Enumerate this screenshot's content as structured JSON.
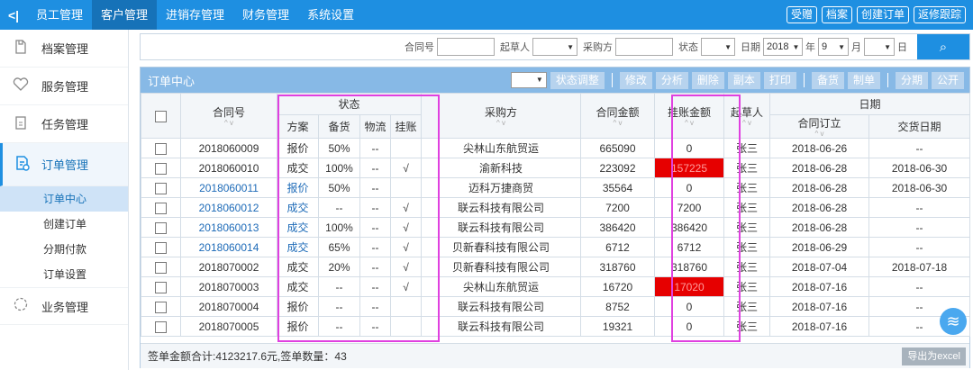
{
  "topnav": {
    "collapse": "<|",
    "items": [
      "员工管理",
      "客户管理",
      "进销存管理",
      "财务管理",
      "系统设置"
    ],
    "right_buttons": [
      "受赠",
      "档案",
      "创建订单",
      "返修跟踪"
    ]
  },
  "sidebar": {
    "items": [
      {
        "label": "档案管理",
        "icon": "file-icon"
      },
      {
        "label": "服务管理",
        "icon": "heart-icon"
      },
      {
        "label": "任务管理",
        "icon": "clipboard-icon"
      },
      {
        "label": "订单管理",
        "icon": "order-icon"
      },
      {
        "label": "业务管理",
        "icon": "spinner-icon"
      }
    ],
    "subitems": [
      "订单中心",
      "创建订单",
      "分期付款",
      "订单设置"
    ]
  },
  "search": {
    "contract_label": "合同号",
    "drafter_label": "起草人",
    "buyer_label": "采购方",
    "status_label": "状态",
    "date_label": "日期",
    "year": "2018",
    "year_unit": "年",
    "month": "9",
    "month_unit": "月",
    "day_unit": "日",
    "search_icon": "⌕"
  },
  "panel": {
    "title": "订单中心",
    "status_adjust": "状态调整",
    "tools_a": [
      "修改",
      "分析",
      "删除",
      "副本",
      "打印"
    ],
    "tools_b": [
      "备货",
      "制单"
    ],
    "tools_c": [
      "分期",
      "公开"
    ]
  },
  "table": {
    "headers": {
      "contract": "合同号",
      "status": "状态",
      "scheme": "方案",
      "stock": "备货",
      "logistics": "物流",
      "hang": "挂账",
      "buyer": "采购方",
      "amount": "合同金额",
      "hang_amount": "挂账金额",
      "drafter": "起草人",
      "date": "日期",
      "signed": "合同订立",
      "delivery": "交货日期"
    },
    "rows": [
      {
        "contract": "2018060009",
        "scheme": "报价",
        "stock": "50%",
        "logistics": "--",
        "hang": "",
        "buyer": "尖林山东航贸运",
        "amount": "665090",
        "hang_amount": "0",
        "drafter": "张三",
        "signed": "2018-06-26",
        "delivery": "--",
        "blue": false,
        "red": false
      },
      {
        "contract": "2018060010",
        "scheme": "成交",
        "stock": "100%",
        "logistics": "--",
        "hang": "√",
        "buyer": "渝新科技",
        "amount": "223092",
        "hang_amount": "157225",
        "drafter": "张三",
        "signed": "2018-06-28",
        "delivery": "2018-06-30",
        "blue": false,
        "red": true
      },
      {
        "contract": "2018060011",
        "scheme": "报价",
        "stock": "50%",
        "logistics": "--",
        "hang": "",
        "buyer": "迈科万捷商贸",
        "amount": "35564",
        "hang_amount": "0",
        "drafter": "张三",
        "signed": "2018-06-28",
        "delivery": "2018-06-30",
        "blue": true,
        "red": false
      },
      {
        "contract": "2018060012",
        "scheme": "成交",
        "stock": "--",
        "logistics": "--",
        "hang": "√",
        "buyer": "联云科技有限公司",
        "amount": "7200",
        "hang_amount": "7200",
        "drafter": "张三",
        "signed": "2018-06-28",
        "delivery": "--",
        "blue": true,
        "red": false
      },
      {
        "contract": "2018060013",
        "scheme": "成交",
        "stock": "100%",
        "logistics": "--",
        "hang": "√",
        "buyer": "联云科技有限公司",
        "amount": "386420",
        "hang_amount": "386420",
        "drafter": "张三",
        "signed": "2018-06-28",
        "delivery": "--",
        "blue": true,
        "red": false
      },
      {
        "contract": "2018060014",
        "scheme": "成交",
        "stock": "65%",
        "logistics": "--",
        "hang": "√",
        "buyer": "贝新春科技有限公司",
        "amount": "6712",
        "hang_amount": "6712",
        "drafter": "张三",
        "signed": "2018-06-29",
        "delivery": "--",
        "blue": true,
        "red": false
      },
      {
        "contract": "2018070002",
        "scheme": "成交",
        "stock": "20%",
        "logistics": "--",
        "hang": "√",
        "buyer": "贝新春科技有限公司",
        "amount": "318760",
        "hang_amount": "318760",
        "drafter": "张三",
        "signed": "2018-07-04",
        "delivery": "2018-07-18",
        "blue": false,
        "red": false
      },
      {
        "contract": "2018070003",
        "scheme": "成交",
        "stock": "--",
        "logistics": "--",
        "hang": "√",
        "buyer": "尖林山东航贸运",
        "amount": "16720",
        "hang_amount": "17020",
        "drafter": "张三",
        "signed": "2018-07-16",
        "delivery": "--",
        "blue": false,
        "red": true
      },
      {
        "contract": "2018070004",
        "scheme": "报价",
        "stock": "--",
        "logistics": "--",
        "hang": "",
        "buyer": "联云科技有限公司",
        "amount": "8752",
        "hang_amount": "0",
        "drafter": "张三",
        "signed": "2018-07-16",
        "delivery": "--",
        "blue": false,
        "red": false
      },
      {
        "contract": "2018070005",
        "scheme": "报价",
        "stock": "--",
        "logistics": "--",
        "hang": "",
        "buyer": "联云科技有限公司",
        "amount": "19321",
        "hang_amount": "0",
        "drafter": "张三",
        "signed": "2018-07-16",
        "delivery": "--",
        "blue": false,
        "red": false
      }
    ]
  },
  "footer": {
    "summary": "签单金额合计:4123217.6元,签单数量：43",
    "export": "导出为excel"
  },
  "colors": {
    "primary": "#1e8fe1",
    "highlight_red": "#e60000",
    "link_blue": "#1e6bb8",
    "annotation": "#e040e0"
  }
}
